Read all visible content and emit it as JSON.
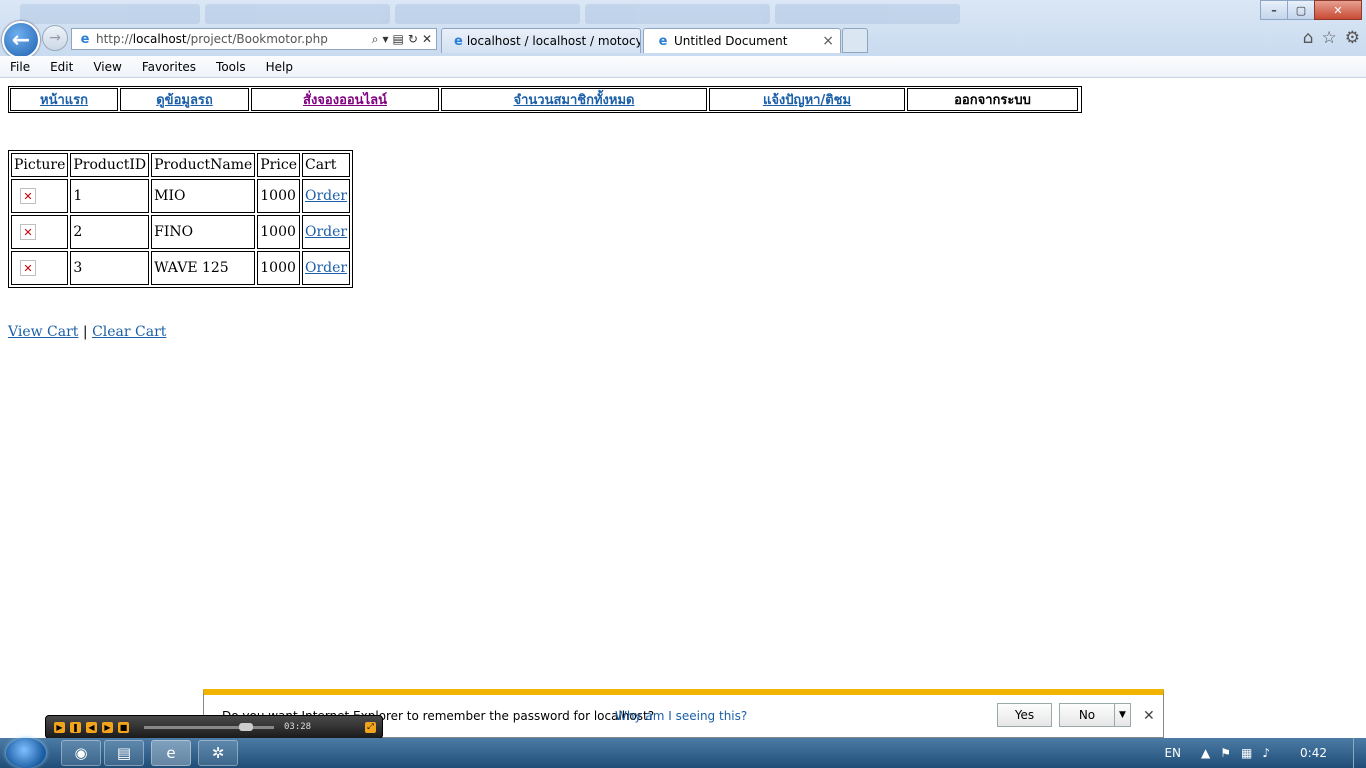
{
  "browser": {
    "address_url_prefix": "http://",
    "address_url_host": "localhost",
    "address_url_path": "/project/Bookmotor.php",
    "tabs": [
      {
        "label": "localhost / localhost / motocy..."
      },
      {
        "label": "Untitled Document"
      }
    ],
    "window_buttons": {
      "minimize": "–",
      "maximize": "▢",
      "close": "✕"
    }
  },
  "menubar": {
    "items": [
      "File",
      "Edit",
      "View",
      "Favorites",
      "Tools",
      "Help"
    ]
  },
  "nav": {
    "items": [
      {
        "label": "หน้าแรก"
      },
      {
        "label": "ดูข้อมูลรถ"
      },
      {
        "label": "สั่งจองออนไลน์"
      },
      {
        "label": "จำนวนสมาชิกทั้งหมด"
      },
      {
        "label": "แจ้งปัญหา/ติชม"
      },
      {
        "label": "ออกจากระบบ"
      }
    ]
  },
  "table": {
    "headers": [
      "Picture",
      "ProductID",
      "ProductName",
      "Price",
      "Cart"
    ],
    "rows": [
      {
        "id": "1",
        "name": "MIO",
        "price": "1000",
        "action": "Order"
      },
      {
        "id": "2",
        "name": "FINO",
        "price": "1000",
        "action": "Order"
      },
      {
        "id": "3",
        "name": "WAVE 125",
        "price": "1000",
        "action": "Order"
      }
    ]
  },
  "cart_links": {
    "view": "View Cart",
    "separator": "|",
    "clear": "Clear Cart"
  },
  "notification": {
    "message": "Do you want Internet Explorer to remember the password for localhost?",
    "why_link": "Why am I seeing this?",
    "yes": "Yes",
    "no": "No"
  },
  "player": {
    "time": "03:28"
  },
  "taskbar": {
    "lang": "EN",
    "clock": "0:42"
  },
  "colors": {
    "link": "#1a5fa8",
    "visited": "#800080",
    "notify_accent": "#f1b400"
  }
}
